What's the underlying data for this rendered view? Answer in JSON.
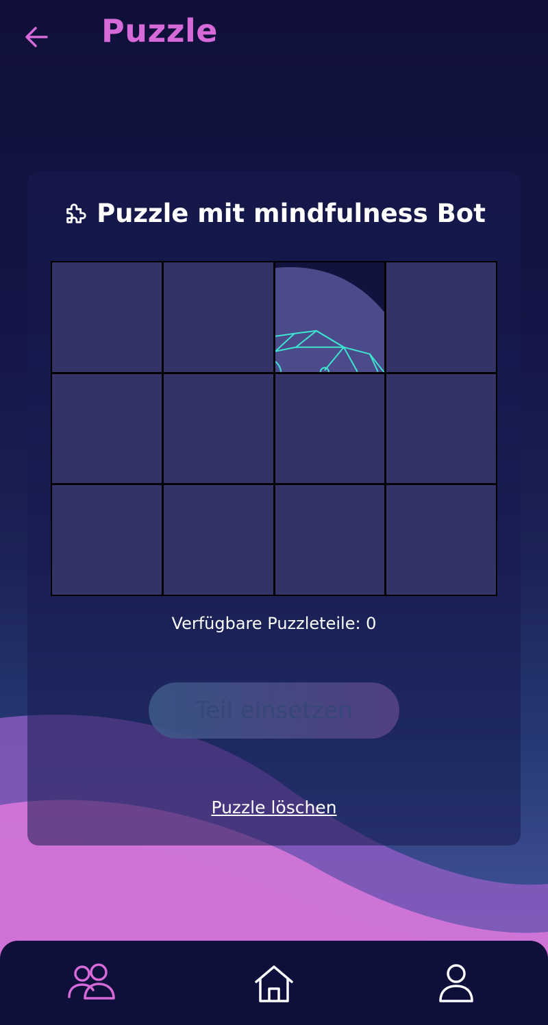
{
  "header": {
    "back_icon": "arrow-left-icon",
    "title": "Puzzle"
  },
  "card": {
    "title_icon": "puzzle-piece-icon",
    "title": "Puzzle mit mindfulness Bot",
    "grid": {
      "rows": 3,
      "cols": 4,
      "revealed_cells": [
        2
      ]
    },
    "available_pieces_label": "Verfügbare Puzzleteile: 0",
    "place_button_label": "Teil einsetzen",
    "delete_link_label": "Puzzle löschen"
  },
  "bottom_nav": {
    "items": [
      {
        "icon": "users-icon",
        "active": true
      },
      {
        "icon": "home-icon",
        "active": false
      },
      {
        "icon": "user-icon",
        "active": false
      }
    ]
  },
  "colors": {
    "accent": "#d66ad8",
    "tile": "#343367",
    "nav_bg": "#0f0f3b",
    "line_art": "#3ee6d2"
  }
}
